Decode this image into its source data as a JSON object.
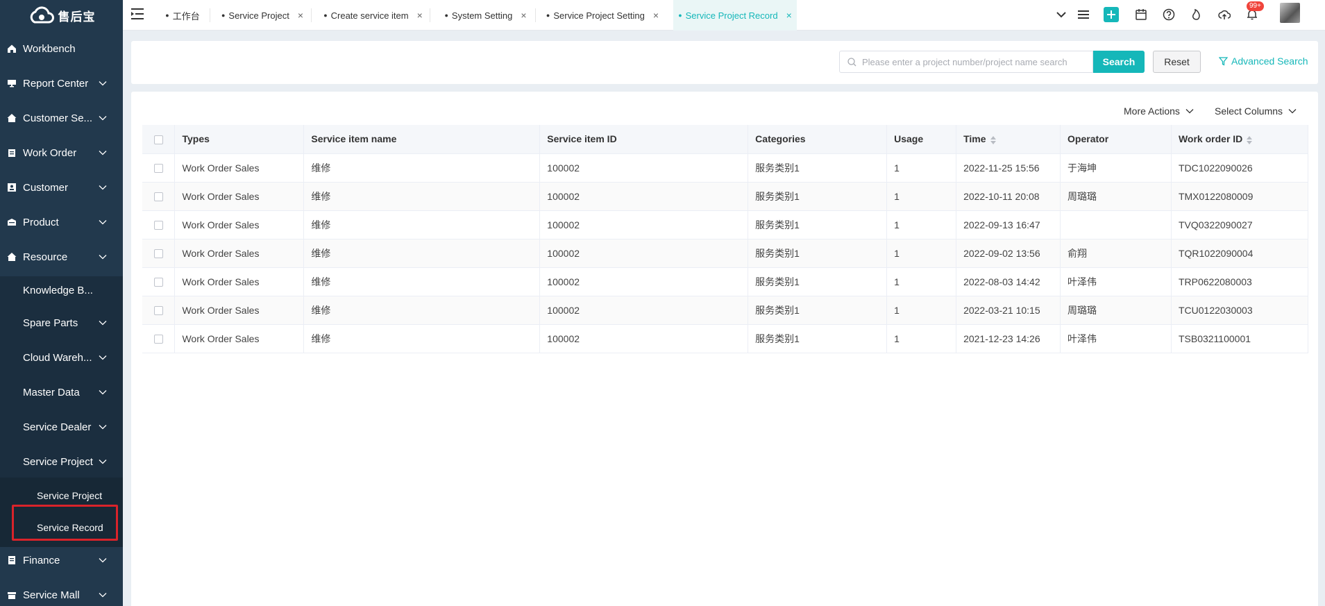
{
  "brand": {
    "name": "售后宝"
  },
  "sidebar": {
    "items": [
      {
        "label": "Workbench",
        "icon": "home-icon"
      },
      {
        "label": "Report Center",
        "icon": "monitor-icon"
      },
      {
        "label": "Customer Se...",
        "icon": "house-icon"
      },
      {
        "label": "Work Order",
        "icon": "clipboard-icon"
      },
      {
        "label": "Customer",
        "icon": "user-card-icon"
      },
      {
        "label": "Product",
        "icon": "box-icon"
      },
      {
        "label": "Resource",
        "icon": "house-icon"
      }
    ],
    "resource_sub": [
      {
        "label": "Knowledge B..."
      },
      {
        "label": "Spare Parts"
      },
      {
        "label": "Cloud Wareh..."
      },
      {
        "label": "Master Data"
      },
      {
        "label": "Service Dealer"
      },
      {
        "label": "Service Project"
      }
    ],
    "service_project_sub": [
      {
        "label": "Service Project"
      },
      {
        "label": "Service Record"
      }
    ],
    "bottom_items": [
      {
        "label": "Finance",
        "icon": "ledger-icon"
      },
      {
        "label": "Service Mall",
        "icon": "store-icon"
      }
    ]
  },
  "tabs": [
    {
      "label": "工作台",
      "closable": false
    },
    {
      "label": "Service Project",
      "closable": true
    },
    {
      "label": "Create service item",
      "closable": true
    },
    {
      "label": "System Setting",
      "closable": true
    },
    {
      "label": "Service Project Setting",
      "closable": true
    },
    {
      "label": "Service Project Record",
      "closable": true,
      "active": true
    }
  ],
  "notifications": {
    "count": "99+"
  },
  "search": {
    "placeholder": "Please enter a project number/project name search",
    "search_label": "Search",
    "reset_label": "Reset",
    "advanced_label": "Advanced Search"
  },
  "table_toolbar": {
    "more_actions": "More Actions",
    "select_columns": "Select Columns"
  },
  "table": {
    "columns": [
      "Types",
      "Service item name",
      "Service item ID",
      "Categories",
      "Usage",
      "Time",
      "Operator",
      "Work order ID"
    ],
    "rows": [
      [
        "Work Order Sales",
        "维修",
        "100002",
        "服务类别1",
        "1",
        "2022-11-25 15:56",
        "于海坤",
        "TDC1022090026"
      ],
      [
        "Work Order Sales",
        "维修",
        "100002",
        "服务类别1",
        "1",
        "2022-10-11 20:08",
        "周璐璐",
        "TMX0122080009"
      ],
      [
        "Work Order Sales",
        "维修",
        "100002",
        "服务类别1",
        "1",
        "2022-09-13 16:47",
        "",
        "TVQ0322090027"
      ],
      [
        "Work Order Sales",
        "维修",
        "100002",
        "服务类别1",
        "1",
        "2022-09-02 13:56",
        "俞翔",
        "TQR1022090004"
      ],
      [
        "Work Order Sales",
        "维修",
        "100002",
        "服务类别1",
        "1",
        "2022-08-03 14:42",
        "叶泽伟",
        "TRP0622080003"
      ],
      [
        "Work Order Sales",
        "维修",
        "100002",
        "服务类别1",
        "1",
        "2022-03-21 10:15",
        "周璐璐",
        "TCU0122030003"
      ],
      [
        "Work Order Sales",
        "维修",
        "100002",
        "服务类别1",
        "1",
        "2021-12-23 14:26",
        "叶泽伟",
        "TSB0321100001"
      ]
    ]
  },
  "colors": {
    "accent": "#15b7b9",
    "sidebar": "#22394d",
    "highlight": "#d9232a"
  }
}
